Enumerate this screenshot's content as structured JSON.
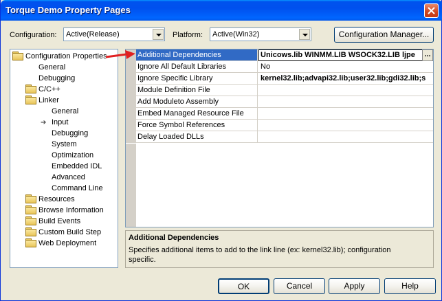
{
  "window": {
    "title": "Torque Demo Property Pages"
  },
  "config": {
    "configuration_label": "Configuration:",
    "configuration_value": "Active(Release)",
    "platform_label": "Platform:",
    "platform_value": "Active(Win32)",
    "manager_button": "Configuration Manager..."
  },
  "tree": {
    "items": [
      {
        "label": "Configuration Properties",
        "icon": "folder-open-icon"
      },
      {
        "label": "General"
      },
      {
        "label": "Debugging"
      },
      {
        "label": "C/C++",
        "icon": "folder-icon"
      },
      {
        "label": "Linker",
        "icon": "folder-open-icon"
      },
      {
        "label": "General"
      },
      {
        "label": "Input",
        "icon": "current-page-arrow-icon"
      },
      {
        "label": "Debugging"
      },
      {
        "label": "System"
      },
      {
        "label": "Optimization"
      },
      {
        "label": "Embedded IDL"
      },
      {
        "label": "Advanced"
      },
      {
        "label": "Command Line"
      },
      {
        "label": "Resources",
        "icon": "folder-icon"
      },
      {
        "label": "Browse Information",
        "icon": "folder-icon"
      },
      {
        "label": "Build Events",
        "icon": "folder-icon"
      },
      {
        "label": "Custom Build Step",
        "icon": "folder-icon"
      },
      {
        "label": "Web Deployment",
        "icon": "folder-icon"
      }
    ]
  },
  "grid": {
    "rows": [
      {
        "name": "Additional Dependencies",
        "value": "Unicows.lib WINMM.LIB WSOCK32.LIB ljpe",
        "selected": true
      },
      {
        "name": "Ignore All Default Libraries",
        "value": "No"
      },
      {
        "name": "Ignore Specific Library",
        "value": "kernel32.lib;advapi32.lib;user32.lib;gdi32.lib;s"
      },
      {
        "name": "Module Definition File",
        "value": ""
      },
      {
        "name": "Add Moduleto Assembly",
        "value": ""
      },
      {
        "name": "Embed Managed Resource File",
        "value": ""
      },
      {
        "name": "Force Symbol References",
        "value": ""
      },
      {
        "name": "Delay Loaded DLLs",
        "value": ""
      }
    ],
    "ellipsis_label": "..."
  },
  "description": {
    "title": "Additional Dependencies",
    "text": "Specifies additional items to add to the link line (ex: kernel32.lib); configuration specific."
  },
  "buttons": {
    "ok": "OK",
    "cancel": "Cancel",
    "apply": "Apply",
    "help": "Help"
  },
  "colors": {
    "titlebar": "#0053ee",
    "selection": "#316ac5",
    "annotation_arrow": "#e02020"
  }
}
